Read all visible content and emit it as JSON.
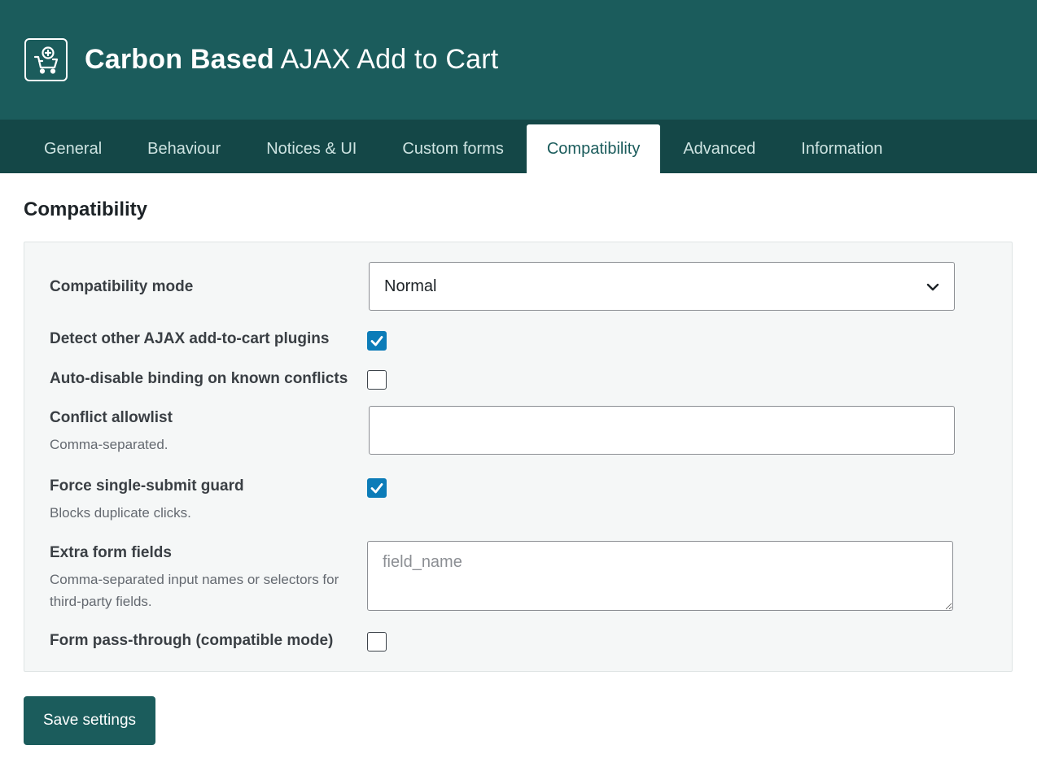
{
  "header": {
    "brand": "Carbon Based",
    "product": " AJAX Add to Cart",
    "logo_icon": "cart-plus-icon"
  },
  "tabs": [
    {
      "label": "General",
      "active": false
    },
    {
      "label": "Behaviour",
      "active": false
    },
    {
      "label": "Notices & UI",
      "active": false
    },
    {
      "label": "Custom forms",
      "active": false
    },
    {
      "label": "Compatibility",
      "active": true
    },
    {
      "label": "Advanced",
      "active": false
    },
    {
      "label": "Information",
      "active": false
    }
  ],
  "section": {
    "title": "Compatibility"
  },
  "settings": {
    "compat_mode": {
      "label": "Compatibility mode",
      "value": "Normal"
    },
    "detect_plugins": {
      "label": "Detect other AJAX add-to-cart plugins",
      "checked": true
    },
    "auto_disable": {
      "label": "Auto-disable binding on known conflicts",
      "checked": false
    },
    "allowlist": {
      "label": "Conflict allowlist",
      "description": "Comma-separated.",
      "value": ""
    },
    "single_submit": {
      "label": "Force single-submit guard",
      "description": "Blocks duplicate clicks.",
      "checked": true
    },
    "extra_fields": {
      "label": "Extra form fields",
      "description": "Comma-separated input names or selectors for third-party fields.",
      "placeholder": "field_name",
      "value": ""
    },
    "pass_through": {
      "label": "Form pass-through (compatible mode)",
      "checked": false
    }
  },
  "actions": {
    "save_label": "Save settings"
  },
  "colors": {
    "header_bg": "#1b5c5c",
    "tabs_bg": "#144747",
    "checkbox_checked": "#0c7cb8"
  }
}
